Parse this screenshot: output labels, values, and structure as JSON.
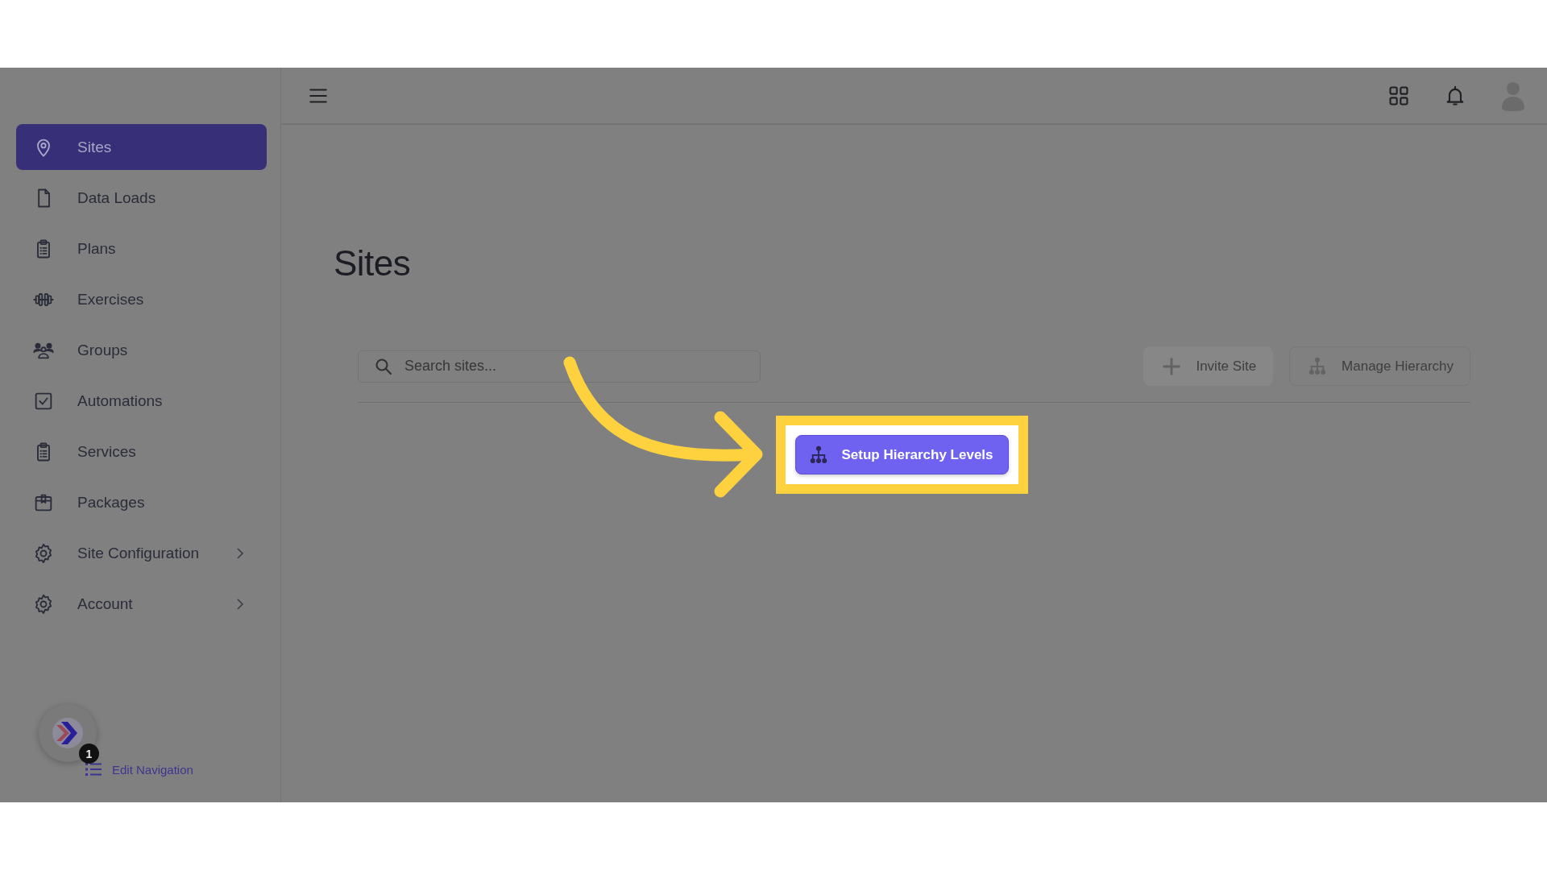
{
  "nav": {
    "items": [
      {
        "label": "Sites",
        "kind": "pin",
        "selected": true,
        "has_submenu": false
      },
      {
        "label": "Data Loads",
        "kind": "file",
        "selected": false,
        "has_submenu": false
      },
      {
        "label": "Plans",
        "kind": "clipboard",
        "selected": false,
        "has_submenu": false
      },
      {
        "label": "Exercises",
        "kind": "dumbbell",
        "selected": false,
        "has_submenu": false
      },
      {
        "label": "Groups",
        "kind": "people",
        "selected": false,
        "has_submenu": false
      },
      {
        "label": "Automations",
        "kind": "checkbox",
        "selected": false,
        "has_submenu": false
      },
      {
        "label": "Services",
        "kind": "clipboard",
        "selected": false,
        "has_submenu": false
      },
      {
        "label": "Packages",
        "kind": "package",
        "selected": false,
        "has_submenu": false
      },
      {
        "label": "Site Configuration",
        "kind": "gear",
        "selected": false,
        "has_submenu": true
      },
      {
        "label": "Account",
        "kind": "gear",
        "selected": false,
        "has_submenu": true
      }
    ]
  },
  "assistant": {
    "badge": "1"
  },
  "edit_navigation": {
    "label": "Edit Navigation"
  },
  "page": {
    "title": "Sites"
  },
  "search": {
    "placeholder": "Search sites..."
  },
  "actions": [
    {
      "label": "Invite Site",
      "kind": "plus"
    },
    {
      "label": "Manage Hierarchy",
      "kind": "hierarchy"
    }
  ],
  "setup_button": {
    "label": "Setup Hierarchy Levels"
  }
}
